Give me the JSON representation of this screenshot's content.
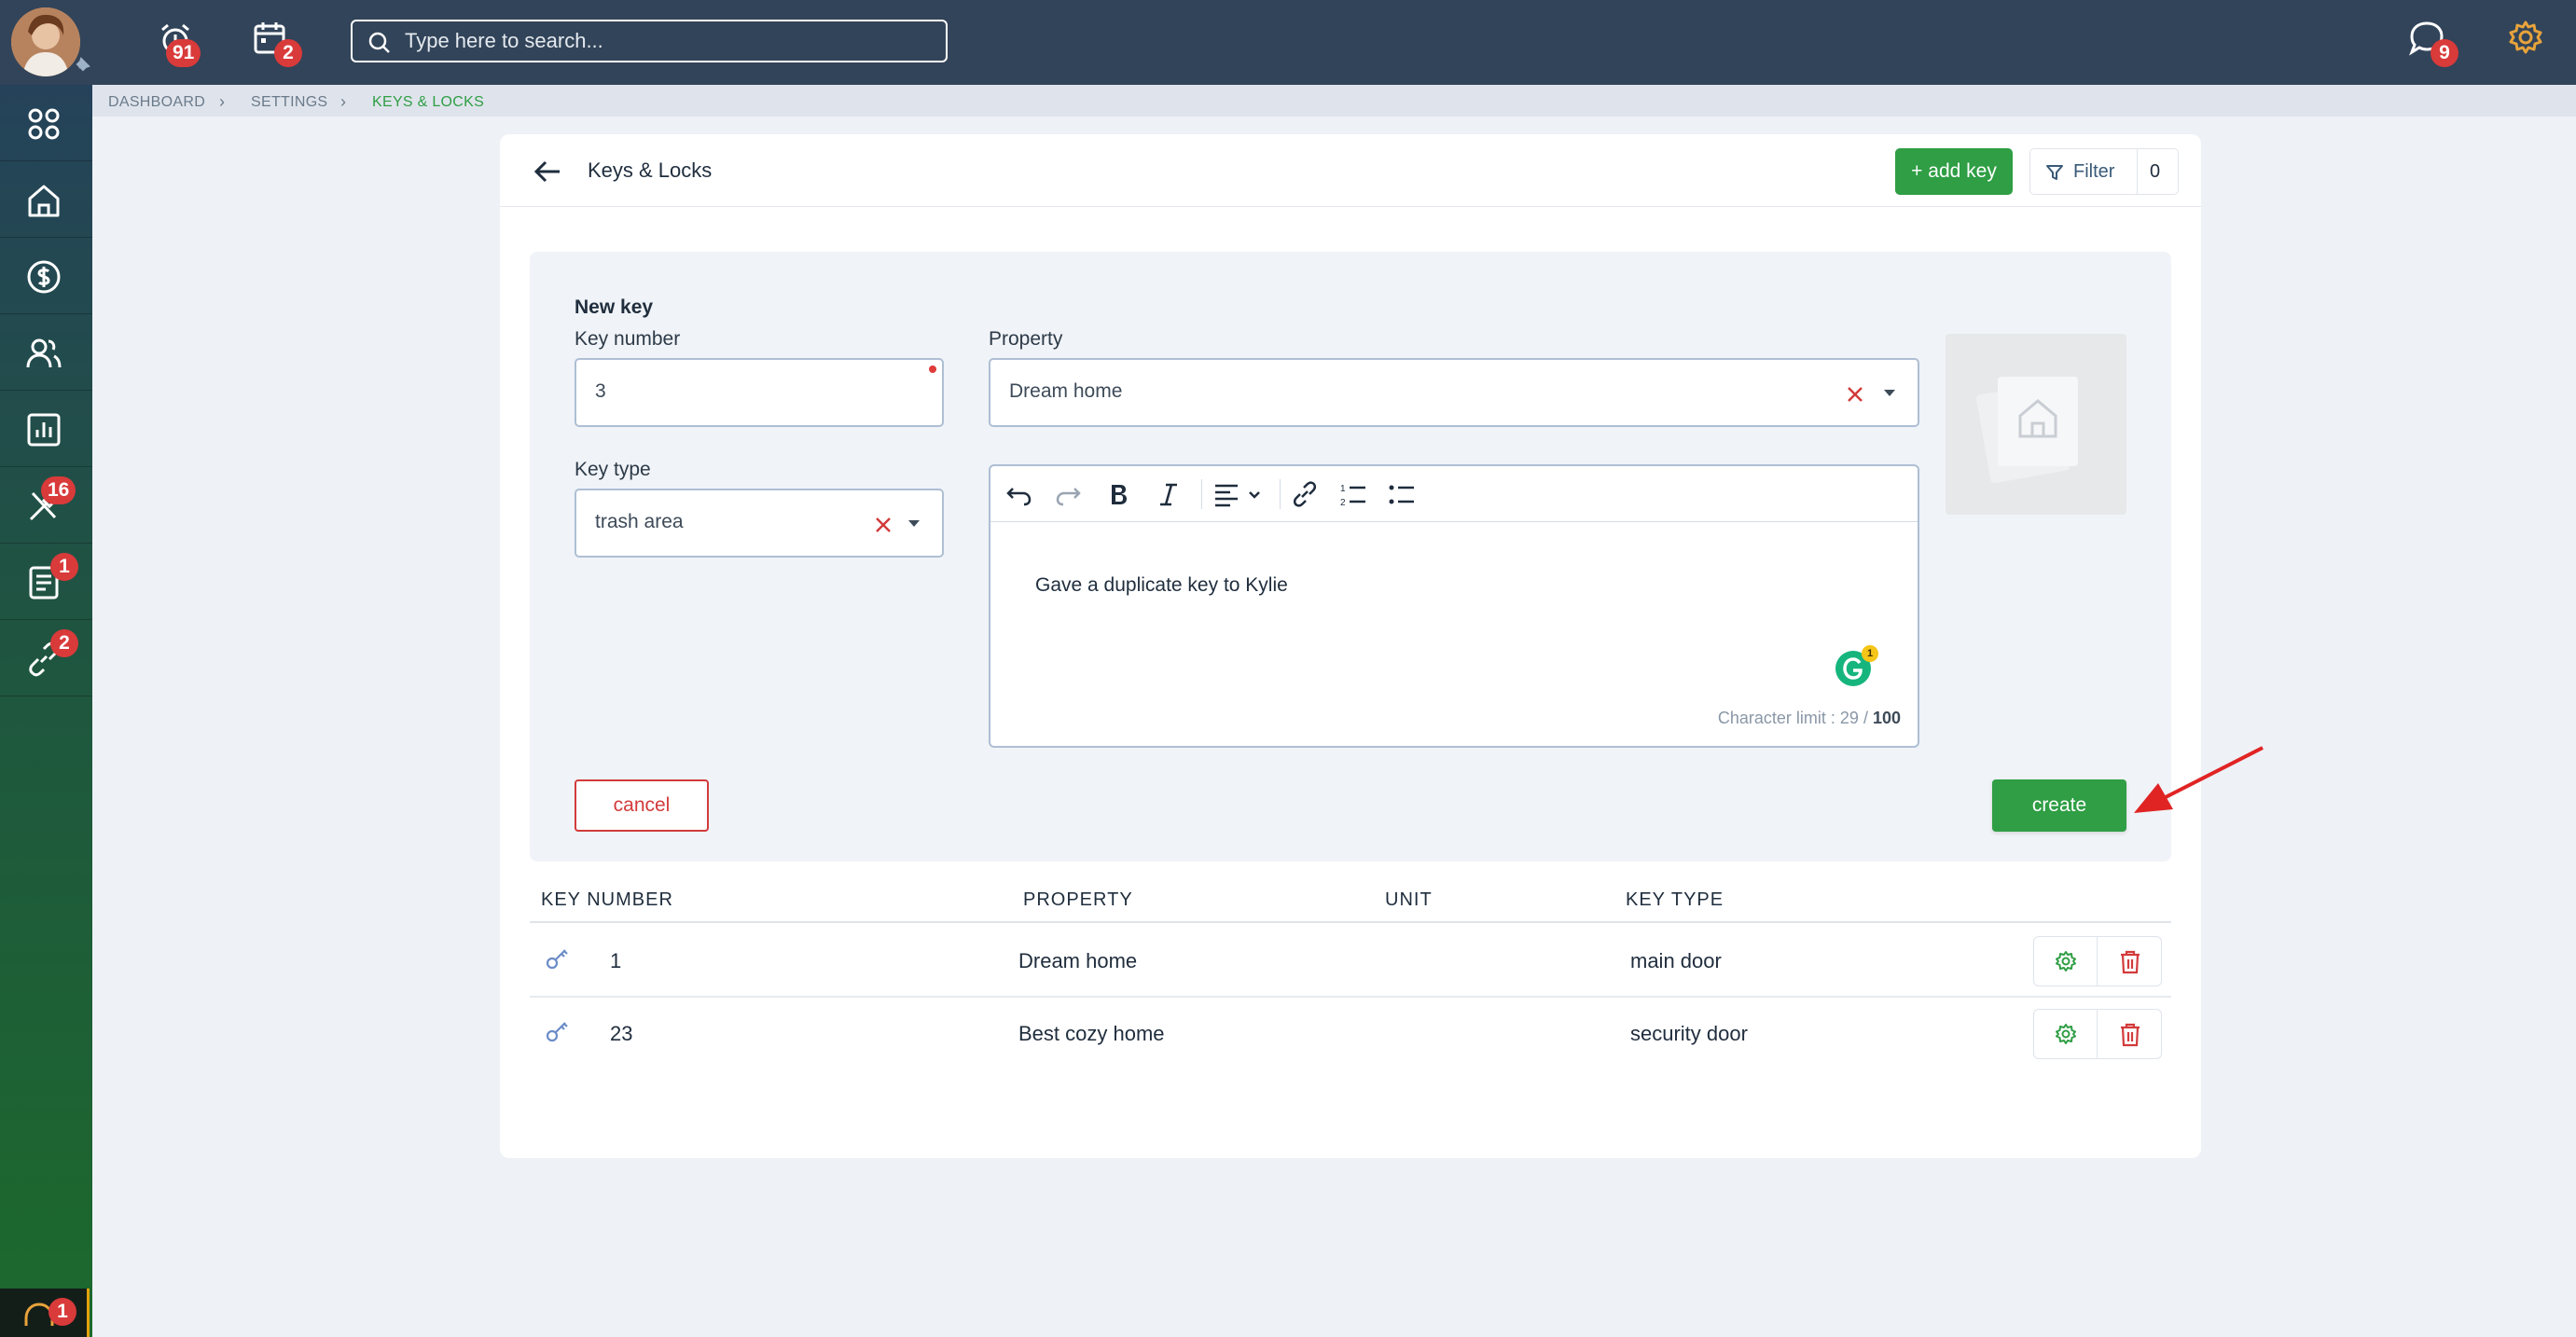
{
  "topbar": {
    "notifications_count": "91",
    "calendar_count": "2",
    "search_placeholder": "Type here to search...",
    "messages_count": "9"
  },
  "sidebar": {
    "items": [
      {
        "icon": "apps-grid-icon"
      },
      {
        "icon": "home-icon"
      },
      {
        "icon": "dollar-icon"
      },
      {
        "icon": "users-icon"
      },
      {
        "icon": "chart-icon"
      },
      {
        "icon": "tools-icon",
        "badge": "16"
      },
      {
        "icon": "document-icon",
        "badge": "1"
      },
      {
        "icon": "link-icon",
        "badge": "2"
      }
    ],
    "support_badge": "1"
  },
  "breadcrumb": {
    "items": [
      "DASHBOARD",
      "SETTINGS",
      "KEYS & LOCKS"
    ]
  },
  "page": {
    "title": "Keys & Locks",
    "add_key_label": "+ add key",
    "filter_label": "Filter",
    "filter_count": "0"
  },
  "form": {
    "title": "New key",
    "key_number_label": "Key number",
    "key_number_value": "3",
    "property_label": "Property",
    "property_value": "Dream home",
    "key_type_label": "Key type",
    "key_type_value": "trash area",
    "notes": "Gave a duplicate key to Kylie",
    "char_limit_label": "Character limit : ",
    "char_count": "29",
    "char_sep": " / ",
    "char_max": "100",
    "grammarly_count": "1",
    "cancel_label": "cancel",
    "create_label": "create"
  },
  "table": {
    "headers": [
      "KEY NUMBER",
      "PROPERTY",
      "UNIT",
      "KEY TYPE"
    ],
    "rows": [
      {
        "key_number": "1",
        "property": "Dream home",
        "unit": "",
        "key_type": "main door"
      },
      {
        "key_number": "23",
        "property": "Best cozy home",
        "unit": "",
        "key_type": "security door"
      }
    ]
  },
  "colors": {
    "topbar": "#324459",
    "accent_green": "#2f9e44",
    "danger_red": "#d23b3b",
    "settings_orange": "#e8a33b"
  }
}
